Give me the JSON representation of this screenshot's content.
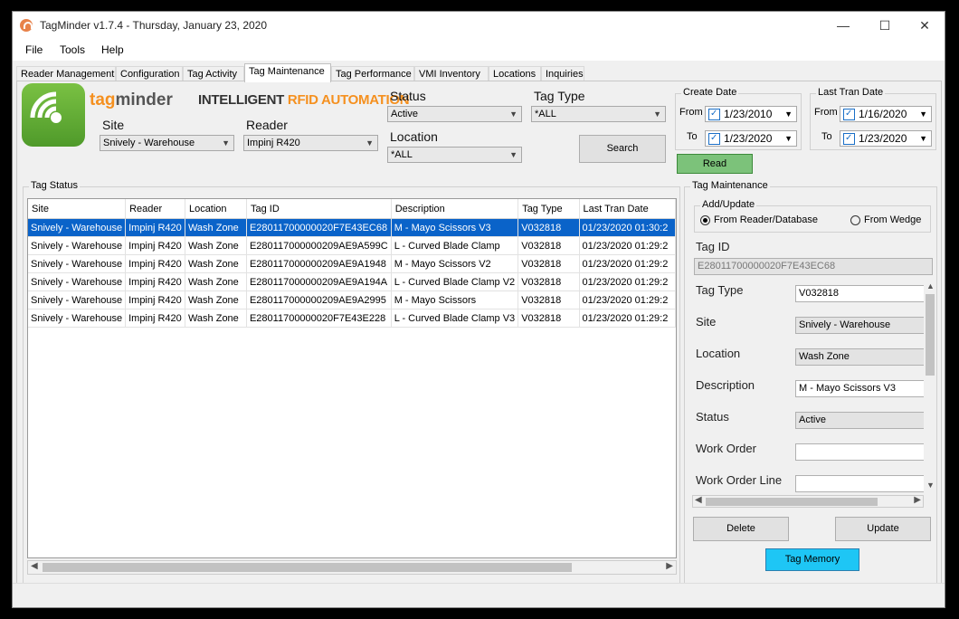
{
  "window": {
    "title": "TagMinder v1.7.4 - Thursday, January 23, 2020",
    "minimize": "—",
    "maximize": "☐",
    "close": "✕"
  },
  "menu": [
    {
      "label": "File"
    },
    {
      "label": "Tools"
    },
    {
      "label": "Help"
    }
  ],
  "tabs": [
    {
      "label": "Reader Management"
    },
    {
      "label": "Configuration"
    },
    {
      "label": "Tag Activity"
    },
    {
      "label": "Tag Maintenance"
    },
    {
      "label": "Tag Performance"
    },
    {
      "label": "VMI Inventory"
    },
    {
      "label": "Locations"
    },
    {
      "label": "Inquiries"
    }
  ],
  "brand": {
    "tag": "tag",
    "minder": "minder",
    "tagline_a": "INTELLIGENT ",
    "tagline_b": "RFID AUTOMATION"
  },
  "filters": {
    "site_label": "Site",
    "site_value": "Snively - Warehouse",
    "reader_label": "Reader",
    "reader_value": "Impinj R420",
    "status_label": "Status",
    "status_value": "Active",
    "tagtype_label": "Tag Type",
    "tagtype_value": "*ALL",
    "location_label": "Location",
    "location_value": "*ALL",
    "search_button": "Search",
    "read_button": "Read"
  },
  "create_date": {
    "title": "Create Date",
    "from_label": "From",
    "from_value": "1/23/2010",
    "to_label": "To",
    "to_value": "1/23/2020"
  },
  "last_tran_date": {
    "title": "Last Tran Date",
    "from_label": "From",
    "from_value": "1/16/2020",
    "to_label": "To",
    "to_value": "1/23/2020"
  },
  "tag_status": {
    "title": "Tag Status",
    "columns": [
      "Site",
      "Reader",
      "Location",
      "Tag ID",
      "Description",
      "Tag Type",
      "Last Tran Date"
    ],
    "rows": [
      [
        "Snively - Warehouse",
        "Impinj R420",
        "Wash Zone",
        "E28011700000020F7E43EC68",
        "M - Mayo Scissors V3",
        "V032818",
        "01/23/2020 01:30:2"
      ],
      [
        "Snively - Warehouse",
        "Impinj R420",
        "Wash Zone",
        "E280117000000209AE9A599C",
        "L - Curved Blade Clamp",
        "V032818",
        "01/23/2020 01:29:2"
      ],
      [
        "Snively - Warehouse",
        "Impinj R420",
        "Wash Zone",
        "E280117000000209AE9A1948",
        "M - Mayo Scissors V2",
        "V032818",
        "01/23/2020 01:29:2"
      ],
      [
        "Snively - Warehouse",
        "Impinj R420",
        "Wash Zone",
        "E280117000000209AE9A194A",
        "L - Curved Blade Clamp V2",
        "V032818",
        "01/23/2020 01:29:2"
      ],
      [
        "Snively - Warehouse",
        "Impinj R420",
        "Wash Zone",
        "E280117000000209AE9A2995",
        "M - Mayo Scissors",
        "V032818",
        "01/23/2020 01:29:2"
      ],
      [
        "Snively - Warehouse",
        "Impinj R420",
        "Wash Zone",
        "E28011700000020F7E43E228",
        "L - Curved Blade Clamp V3",
        "V032818",
        "01/23/2020 01:29:2"
      ]
    ]
  },
  "maintenance": {
    "title": "Tag Maintenance",
    "add_update_title": "Add/Update",
    "radio_reader": "From Reader/Database",
    "radio_wedge": "From Wedge",
    "tagid_label": "Tag ID",
    "tagid_value": "E28011700000020F7E43EC68",
    "tagtype_label": "Tag Type",
    "tagtype_value": "V032818",
    "site_label": "Site",
    "site_value": "Snively - Warehouse",
    "location_label": "Location",
    "location_value": "Wash Zone",
    "description_label": "Description",
    "description_value": "M - Mayo Scissors V3",
    "status_label": "Status",
    "status_value": "Active",
    "workorder_label": "Work Order",
    "workorder_value": "",
    "workorderline_label": "Work Order Line",
    "workorderline_value": "",
    "delete_button": "Delete",
    "update_button": "Update",
    "tagmemory_button": "Tag Memory"
  },
  "colors": {
    "selection": "#0a63c9",
    "read_button": "#7cc27a",
    "tagmemory_button": "#1ec6f5",
    "brand_orange": "#f5901f"
  }
}
